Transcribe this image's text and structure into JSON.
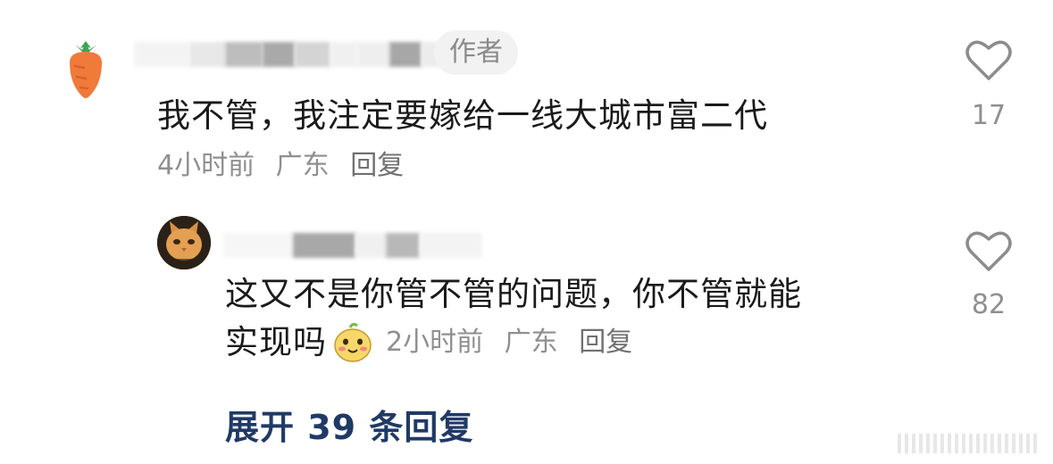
{
  "comments": [
    {
      "badge": "作者",
      "text": "我不管，我注定要嫁给一线大城市富二代",
      "time": "4小时前",
      "location": "广东",
      "reply_label": "回复",
      "likes": "17"
    },
    {
      "text_line1": "这又不是你管不管的问题，你不管就能",
      "text_line2": "实现吗",
      "time": "2小时前",
      "location": "广东",
      "reply_label": "回复",
      "likes": "82"
    }
  ],
  "expand_label": "展开 39 条回复",
  "icons": {
    "avatar1": "carrot-avatar-icon",
    "avatar2": "cat-avatar-icon",
    "like": "heart-outline-icon",
    "emoji": "blushing-face-emoji-icon"
  },
  "colors": {
    "link": "#203a66",
    "meta": "#8f8f8f",
    "text": "#1a1a1a",
    "carrot": "#f07a3a",
    "leaf": "#3aa84f"
  }
}
